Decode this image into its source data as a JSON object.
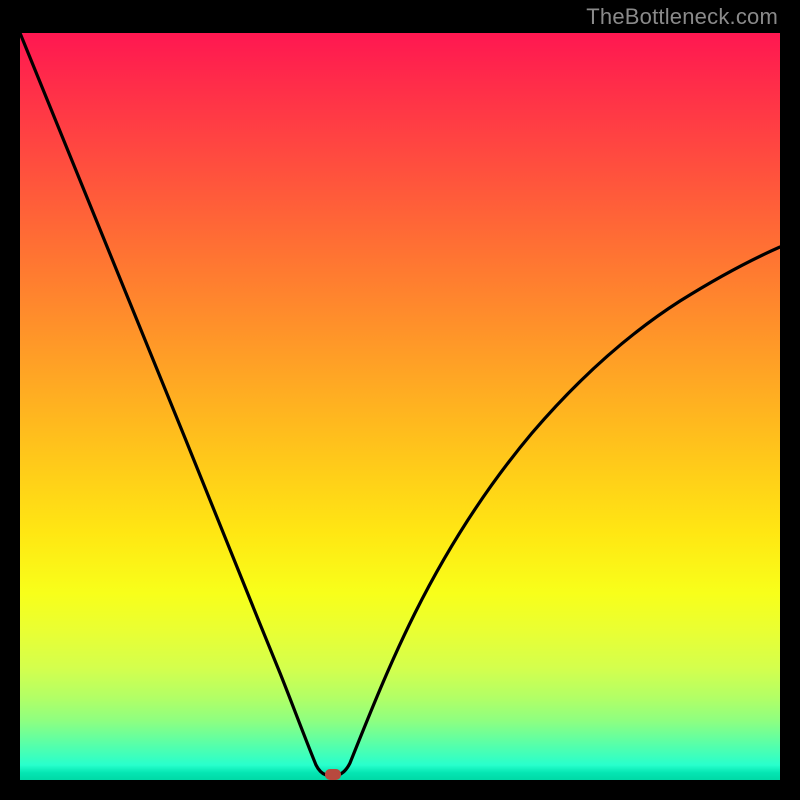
{
  "watermark": {
    "text": "TheBottleneck.com"
  },
  "chart_data": {
    "type": "line",
    "title": "",
    "xlabel": "",
    "ylabel": "",
    "xlim": [
      0,
      100
    ],
    "ylim": [
      0,
      100
    ],
    "grid": false,
    "legend": false,
    "series": [
      {
        "name": "bottleneck-curve",
        "x": [
          0,
          5,
          10,
          15,
          20,
          25,
          30,
          33,
          35,
          37,
          38.5,
          40,
          41,
          42,
          45,
          50,
          55,
          60,
          65,
          70,
          75,
          80,
          85,
          90,
          95,
          100
        ],
        "y": [
          100,
          87,
          74,
          61,
          48,
          35,
          22,
          14,
          8,
          4,
          1,
          0,
          0,
          1,
          6,
          13,
          20,
          26,
          32,
          37,
          42,
          46,
          50,
          53,
          56,
          58
        ]
      }
    ],
    "marker": {
      "x": 40.5,
      "y": 0.5,
      "color": "#b8493e",
      "shape": "rounded-rect"
    },
    "background_gradient": {
      "direction": "vertical",
      "stops": [
        {
          "pos": 0.0,
          "color": "#ff1751"
        },
        {
          "pos": 0.5,
          "color": "#ffb020"
        },
        {
          "pos": 0.75,
          "color": "#f8ff1a"
        },
        {
          "pos": 1.0,
          "color": "#00d9a6"
        }
      ]
    }
  }
}
